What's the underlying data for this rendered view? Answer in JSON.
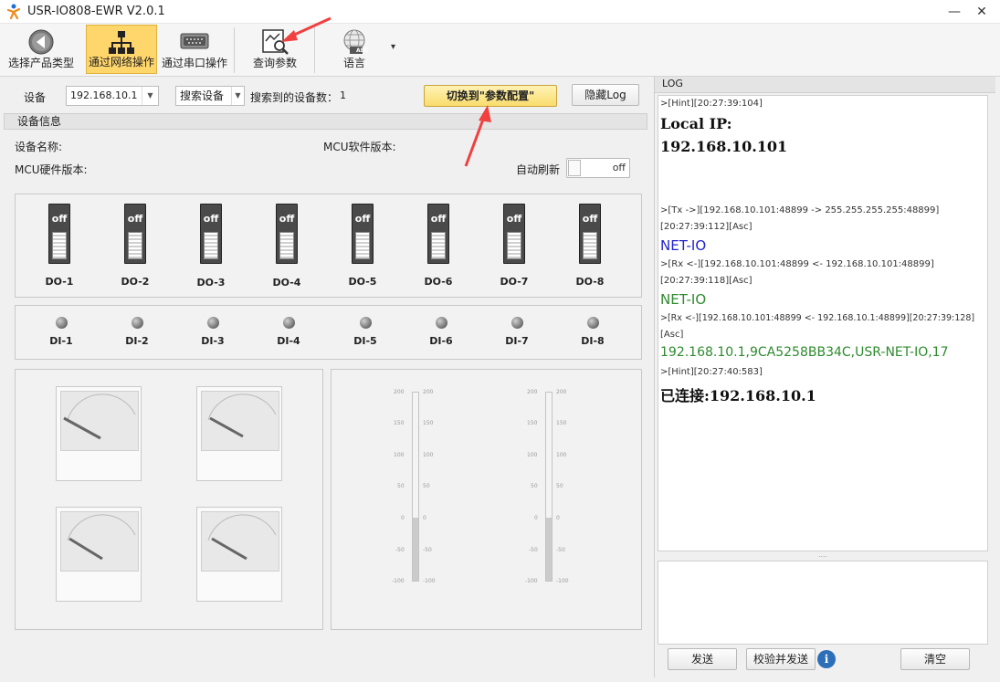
{
  "window": {
    "title": "USR-IO808-EWR V2.0.1",
    "min": "—",
    "max": "☐",
    "close": "✕"
  },
  "toolbar": {
    "items": [
      {
        "label": "选择产品类型"
      },
      {
        "label": "通过网络操作"
      },
      {
        "label": "通过串口操作"
      },
      {
        "label": "查询参数"
      },
      {
        "label": "语言"
      }
    ],
    "lang_badge": "ABC",
    "more": "▾"
  },
  "device": {
    "label": "设备",
    "ip": "192.168.10.1",
    "search_label": "搜索设备",
    "count_label": "搜索到的设备数：",
    "count": "1",
    "switch_btn": "切换到\"参数配置\"",
    "hide_log": "隐藏Log"
  },
  "info": {
    "header": "设备信息",
    "name_label": "设备名称:",
    "mcu_sw_label": "MCU软件版本:",
    "mcu_hw_label": "MCU硬件版本:",
    "auto_refresh_label": "自动刷新",
    "auto_refresh_state": "off"
  },
  "outputs": [
    {
      "name": "DO-1",
      "state": "off"
    },
    {
      "name": "DO-2",
      "state": "off"
    },
    {
      "name": "DO-3",
      "state": "off"
    },
    {
      "name": "DO-4",
      "state": "off"
    },
    {
      "name": "DO-5",
      "state": "off"
    },
    {
      "name": "DO-6",
      "state": "off"
    },
    {
      "name": "DO-7",
      "state": "off"
    },
    {
      "name": "DO-8",
      "state": "off"
    }
  ],
  "inputs": [
    "DI-1",
    "DI-2",
    "DI-3",
    "DI-4",
    "DI-5",
    "DI-6",
    "DI-7",
    "DI-8"
  ],
  "thermo_ticks": [
    "200",
    "150",
    "100",
    "50",
    "0",
    "-50",
    "-100"
  ],
  "log": {
    "header": "LOG",
    "lines": [
      {
        "text": ">[Hint][20:27:39:104]",
        "style": "small"
      },
      {
        "text": "Local IP:",
        "style": "big"
      },
      {
        "text": "192.168.10.101",
        "style": "big"
      },
      {
        "text": ">[Tx ->][192.168.10.101:48899 -> 255.255.255.255:48899]",
        "style": "small"
      },
      {
        "text": "[20:27:39:112][Asc]",
        "style": "small"
      },
      {
        "text": "NET-IO",
        "style": "blue"
      },
      {
        "text": ">[Rx <-][192.168.10.101:48899 <- 192.168.10.101:48899]",
        "style": "small"
      },
      {
        "text": "[20:27:39:118][Asc]",
        "style": "small"
      },
      {
        "text": "NET-IO",
        "style": "green"
      },
      {
        "text": ">[Rx <-][192.168.10.101:48899 <- 192.168.10.1:48899][20:27:39:128]",
        "style": "small"
      },
      {
        "text": "[Asc]",
        "style": "small"
      },
      {
        "text": "192.168.10.1,9CA5258BB34C,USR-NET-IO,17",
        "style": "green"
      },
      {
        "text": ">[Hint][20:27:40:583]",
        "style": "small"
      },
      {
        "text": "已连接:192.168.10.1",
        "style": "big"
      }
    ],
    "splitter": "....",
    "send": "发送",
    "check_send": "校验并发送",
    "info": "i",
    "clear": "清空"
  },
  "colors": {
    "active_tab": "#ffd66b",
    "annotation_arrow": "#f04040",
    "log_blue": "#2222cc",
    "log_green": "#2e8b2e"
  }
}
